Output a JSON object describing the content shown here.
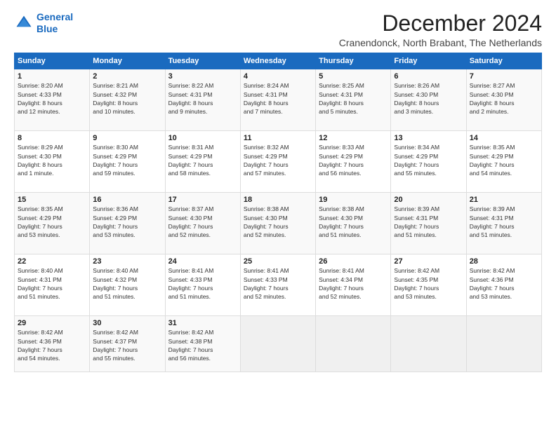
{
  "logo": {
    "line1": "General",
    "line2": "Blue"
  },
  "title": "December 2024",
  "subtitle": "Cranendonck, North Brabant, The Netherlands",
  "weekdays": [
    "Sunday",
    "Monday",
    "Tuesday",
    "Wednesday",
    "Thursday",
    "Friday",
    "Saturday"
  ],
  "weeks": [
    [
      {
        "day": "1",
        "info": "Sunrise: 8:20 AM\nSunset: 4:33 PM\nDaylight: 8 hours\nand 12 minutes."
      },
      {
        "day": "2",
        "info": "Sunrise: 8:21 AM\nSunset: 4:32 PM\nDaylight: 8 hours\nand 10 minutes."
      },
      {
        "day": "3",
        "info": "Sunrise: 8:22 AM\nSunset: 4:31 PM\nDaylight: 8 hours\nand 9 minutes."
      },
      {
        "day": "4",
        "info": "Sunrise: 8:24 AM\nSunset: 4:31 PM\nDaylight: 8 hours\nand 7 minutes."
      },
      {
        "day": "5",
        "info": "Sunrise: 8:25 AM\nSunset: 4:31 PM\nDaylight: 8 hours\nand 5 minutes."
      },
      {
        "day": "6",
        "info": "Sunrise: 8:26 AM\nSunset: 4:30 PM\nDaylight: 8 hours\nand 3 minutes."
      },
      {
        "day": "7",
        "info": "Sunrise: 8:27 AM\nSunset: 4:30 PM\nDaylight: 8 hours\nand 2 minutes."
      }
    ],
    [
      {
        "day": "8",
        "info": "Sunrise: 8:29 AM\nSunset: 4:30 PM\nDaylight: 8 hours\nand 1 minute."
      },
      {
        "day": "9",
        "info": "Sunrise: 8:30 AM\nSunset: 4:29 PM\nDaylight: 7 hours\nand 59 minutes."
      },
      {
        "day": "10",
        "info": "Sunrise: 8:31 AM\nSunset: 4:29 PM\nDaylight: 7 hours\nand 58 minutes."
      },
      {
        "day": "11",
        "info": "Sunrise: 8:32 AM\nSunset: 4:29 PM\nDaylight: 7 hours\nand 57 minutes."
      },
      {
        "day": "12",
        "info": "Sunrise: 8:33 AM\nSunset: 4:29 PM\nDaylight: 7 hours\nand 56 minutes."
      },
      {
        "day": "13",
        "info": "Sunrise: 8:34 AM\nSunset: 4:29 PM\nDaylight: 7 hours\nand 55 minutes."
      },
      {
        "day": "14",
        "info": "Sunrise: 8:35 AM\nSunset: 4:29 PM\nDaylight: 7 hours\nand 54 minutes."
      }
    ],
    [
      {
        "day": "15",
        "info": "Sunrise: 8:35 AM\nSunset: 4:29 PM\nDaylight: 7 hours\nand 53 minutes."
      },
      {
        "day": "16",
        "info": "Sunrise: 8:36 AM\nSunset: 4:29 PM\nDaylight: 7 hours\nand 53 minutes."
      },
      {
        "day": "17",
        "info": "Sunrise: 8:37 AM\nSunset: 4:30 PM\nDaylight: 7 hours\nand 52 minutes."
      },
      {
        "day": "18",
        "info": "Sunrise: 8:38 AM\nSunset: 4:30 PM\nDaylight: 7 hours\nand 52 minutes."
      },
      {
        "day": "19",
        "info": "Sunrise: 8:38 AM\nSunset: 4:30 PM\nDaylight: 7 hours\nand 51 minutes."
      },
      {
        "day": "20",
        "info": "Sunrise: 8:39 AM\nSunset: 4:31 PM\nDaylight: 7 hours\nand 51 minutes."
      },
      {
        "day": "21",
        "info": "Sunrise: 8:39 AM\nSunset: 4:31 PM\nDaylight: 7 hours\nand 51 minutes."
      }
    ],
    [
      {
        "day": "22",
        "info": "Sunrise: 8:40 AM\nSunset: 4:31 PM\nDaylight: 7 hours\nand 51 minutes."
      },
      {
        "day": "23",
        "info": "Sunrise: 8:40 AM\nSunset: 4:32 PM\nDaylight: 7 hours\nand 51 minutes."
      },
      {
        "day": "24",
        "info": "Sunrise: 8:41 AM\nSunset: 4:33 PM\nDaylight: 7 hours\nand 51 minutes."
      },
      {
        "day": "25",
        "info": "Sunrise: 8:41 AM\nSunset: 4:33 PM\nDaylight: 7 hours\nand 52 minutes."
      },
      {
        "day": "26",
        "info": "Sunrise: 8:41 AM\nSunset: 4:34 PM\nDaylight: 7 hours\nand 52 minutes."
      },
      {
        "day": "27",
        "info": "Sunrise: 8:42 AM\nSunset: 4:35 PM\nDaylight: 7 hours\nand 53 minutes."
      },
      {
        "day": "28",
        "info": "Sunrise: 8:42 AM\nSunset: 4:36 PM\nDaylight: 7 hours\nand 53 minutes."
      }
    ],
    [
      {
        "day": "29",
        "info": "Sunrise: 8:42 AM\nSunset: 4:36 PM\nDaylight: 7 hours\nand 54 minutes."
      },
      {
        "day": "30",
        "info": "Sunrise: 8:42 AM\nSunset: 4:37 PM\nDaylight: 7 hours\nand 55 minutes."
      },
      {
        "day": "31",
        "info": "Sunrise: 8:42 AM\nSunset: 4:38 PM\nDaylight: 7 hours\nand 56 minutes."
      },
      {
        "day": "",
        "info": ""
      },
      {
        "day": "",
        "info": ""
      },
      {
        "day": "",
        "info": ""
      },
      {
        "day": "",
        "info": ""
      }
    ]
  ]
}
